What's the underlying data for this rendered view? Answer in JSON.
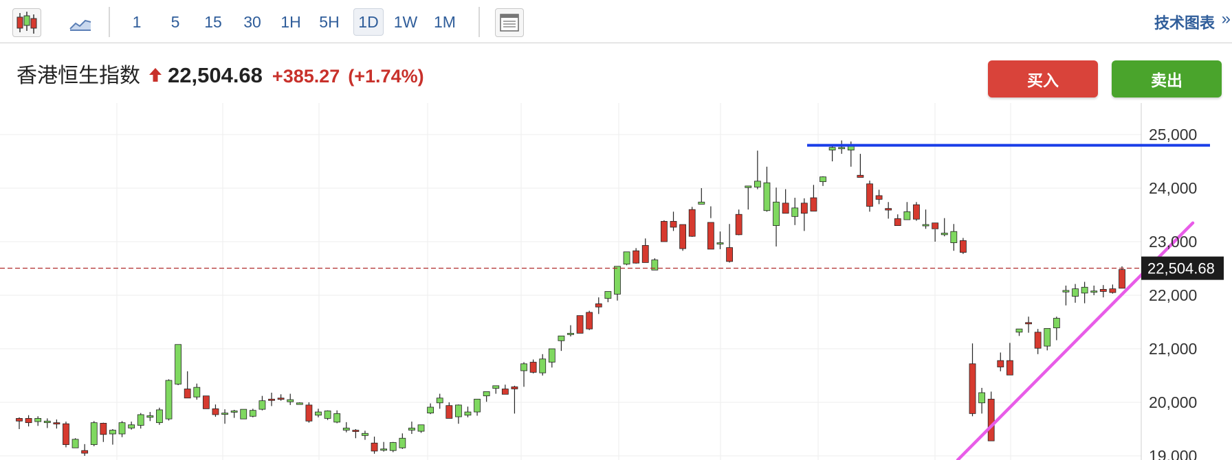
{
  "toolbar": {
    "chart_type_icons": [
      "candlestick-chart-icon",
      "area-chart-icon"
    ],
    "intervals": [
      {
        "label": "1",
        "selected": false
      },
      {
        "label": "5",
        "selected": false
      },
      {
        "label": "15",
        "selected": false
      },
      {
        "label": "30",
        "selected": false
      },
      {
        "label": "1H",
        "selected": false
      },
      {
        "label": "5H",
        "selected": false
      },
      {
        "label": "1D",
        "selected": true
      },
      {
        "label": "1W",
        "selected": false
      },
      {
        "label": "1M",
        "selected": false
      }
    ],
    "layout_icon": "layout-panel-icon",
    "tech_chart_label": "技术图表",
    "tech_chart_chevron": "»"
  },
  "quote": {
    "name": "香港恒生指数",
    "direction_icon": "up-arrow-icon",
    "price": "22,504.68",
    "change": "+385.27",
    "change_pct": "(+1.74%)"
  },
  "actions": {
    "buy_label": "买入",
    "sell_label": "卖出"
  },
  "colors": {
    "up": "#7fd860",
    "down": "#d63a2f",
    "accent": "#2f5d9a",
    "resistance": "#1a3ee8",
    "trendline": "#e85ce8"
  },
  "chart_data": {
    "type": "candlestick",
    "ylim": [
      18900,
      25300
    ],
    "y_ticks": [
      "25,000",
      "24,000",
      "23,000",
      "22,000",
      "21,000",
      "20,000",
      "19,000"
    ],
    "y_tick_values": [
      25000,
      24000,
      23000,
      22000,
      21000,
      20000,
      19000
    ],
    "last_price_value": 22504.68,
    "last_price_label": "22,504.68",
    "candles": [
      [
        19700,
        19720,
        19500,
        19650
      ],
      [
        19700,
        19760,
        19550,
        19620
      ],
      [
        19640,
        19740,
        19560,
        19700
      ],
      [
        19620,
        19700,
        19520,
        19650
      ],
      [
        19620,
        19680,
        19510,
        19600
      ],
      [
        19600,
        19640,
        19160,
        19210
      ],
      [
        19150,
        19330,
        19150,
        19310
      ],
      [
        19100,
        19220,
        19000,
        19050
      ],
      [
        19210,
        19650,
        19180,
        19620
      ],
      [
        19610,
        19620,
        19260,
        19400
      ],
      [
        19410,
        19500,
        19210,
        19480
      ],
      [
        19410,
        19650,
        19350,
        19620
      ],
      [
        19520,
        19640,
        19490,
        19580
      ],
      [
        19570,
        19800,
        19510,
        19770
      ],
      [
        19720,
        19820,
        19650,
        19750
      ],
      [
        19620,
        19900,
        19580,
        19860
      ],
      [
        19690,
        20430,
        19660,
        20410
      ],
      [
        20340,
        21080,
        20320,
        21080
      ],
      [
        20250,
        20580,
        20080,
        20080
      ],
      [
        20100,
        20350,
        20050,
        20280
      ],
      [
        20120,
        20100,
        19880,
        19880
      ],
      [
        19880,
        19960,
        19730,
        19770
      ],
      [
        19800,
        19870,
        19600,
        19800
      ],
      [
        19830,
        19860,
        19710,
        19840
      ],
      [
        19690,
        19860,
        19690,
        19870
      ],
      [
        19740,
        19880,
        19720,
        19850
      ],
      [
        19870,
        20120,
        19850,
        20030
      ],
      [
        20060,
        20180,
        19930,
        20040
      ],
      [
        20080,
        20150,
        20030,
        20060
      ],
      [
        20010,
        20160,
        19950,
        20050
      ],
      [
        19960,
        20000,
        19980,
        19990
      ],
      [
        19950,
        20000,
        19620,
        19650
      ],
      [
        19760,
        19880,
        19720,
        19820
      ],
      [
        19700,
        19850,
        19670,
        19840
      ],
      [
        19630,
        19850,
        19610,
        19790
      ],
      [
        19480,
        19630,
        19440,
        19520
      ],
      [
        19480,
        19500,
        19330,
        19460
      ],
      [
        19380,
        19470,
        19300,
        19420
      ],
      [
        19240,
        19360,
        19040,
        19090
      ],
      [
        19120,
        19260,
        19080,
        19130
      ],
      [
        19100,
        19260,
        19070,
        19250
      ],
      [
        19150,
        19420,
        19130,
        19330
      ],
      [
        19480,
        19640,
        19410,
        19520
      ],
      [
        19460,
        19570,
        19430,
        19580
      ],
      [
        19800,
        19980,
        19780,
        19910
      ],
      [
        19990,
        20160,
        19880,
        20080
      ],
      [
        19940,
        20000,
        19920,
        19700
      ],
      [
        19730,
        19960,
        19600,
        19950
      ],
      [
        19760,
        19920,
        19720,
        19820
      ],
      [
        19820,
        20060,
        19750,
        20060
      ],
      [
        20120,
        20120,
        20010,
        20200
      ],
      [
        20260,
        20280,
        20160,
        20310
      ],
      [
        20250,
        20330,
        20240,
        20150
      ],
      [
        20290,
        20310,
        19790,
        20250
      ],
      [
        20590,
        20750,
        20290,
        20720
      ],
      [
        20750,
        20800,
        20540,
        20560
      ],
      [
        20550,
        20900,
        20500,
        20810
      ],
      [
        20750,
        21000,
        20650,
        21000
      ],
      [
        21150,
        21220,
        20960,
        21240
      ],
      [
        21280,
        21440,
        21230,
        21290
      ],
      [
        21620,
        21600,
        21290,
        21290
      ],
      [
        21680,
        21710,
        21350,
        21370
      ],
      [
        21840,
        21960,
        21650,
        21780
      ],
      [
        21940,
        22020,
        21870,
        22070
      ],
      [
        22020,
        22440,
        21900,
        22540
      ],
      [
        22580,
        22810,
        22560,
        22810
      ],
      [
        22830,
        22880,
        22590,
        22600
      ],
      [
        22930,
        23060,
        22820,
        22610
      ],
      [
        22470,
        22690,
        22490,
        22660
      ],
      [
        23380,
        23400,
        23000,
        23000
      ],
      [
        23380,
        23560,
        23200,
        23270
      ],
      [
        23320,
        23250,
        22830,
        22870
      ],
      [
        23600,
        23650,
        23090,
        23100
      ],
      [
        23700,
        24000,
        23700,
        23740
      ],
      [
        23360,
        23660,
        23440,
        22860
      ],
      [
        22980,
        23190,
        22860,
        22980
      ],
      [
        22890,
        23330,
        22610,
        22630
      ],
      [
        23510,
        23600,
        23120,
        23130
      ],
      [
        24010,
        24040,
        23600,
        24040
      ],
      [
        24020,
        24700,
        23980,
        24130
      ],
      [
        23580,
        24400,
        23560,
        24100
      ],
      [
        23300,
        24010,
        22910,
        23740
      ],
      [
        23720,
        23980,
        23680,
        23530
      ],
      [
        23470,
        23820,
        23310,
        23630
      ],
      [
        23720,
        23810,
        23200,
        23530
      ],
      [
        23820,
        24060,
        23810,
        23570
      ],
      [
        24120,
        24220,
        24040,
        24210
      ],
      [
        24710,
        24790,
        24500,
        24760
      ],
      [
        24750,
        24890,
        24640,
        24760
      ],
      [
        24710,
        24870,
        24400,
        24790
      ],
      [
        24240,
        24640,
        24230,
        24200
      ],
      [
        24080,
        24140,
        23560,
        23660
      ],
      [
        23860,
        23970,
        23700,
        23790
      ],
      [
        23620,
        23740,
        23430,
        23590
      ],
      [
        23430,
        23510,
        23380,
        23300
      ],
      [
        23410,
        23740,
        23410,
        23560
      ],
      [
        23690,
        23740,
        23390,
        23420
      ],
      [
        23320,
        23600,
        23240,
        23320
      ],
      [
        23350,
        23230,
        23000,
        23240
      ],
      [
        23130,
        23440,
        23100,
        23160
      ],
      [
        22980,
        23330,
        22830,
        23190
      ],
      [
        23020,
        23070,
        22770,
        22800
      ],
      [
        20720,
        21100,
        19740,
        19790
      ],
      [
        19990,
        20270,
        19790,
        20180
      ],
      [
        20060,
        20200,
        19280,
        19280
      ],
      [
        20780,
        20930,
        20580,
        20660
      ],
      [
        20780,
        21110,
        20540,
        20510
      ],
      [
        21310,
        21340,
        21240,
        21370
      ],
      [
        21490,
        21600,
        21300,
        21480
      ],
      [
        21310,
        21370,
        20900,
        21010
      ],
      [
        21050,
        21360,
        20970,
        21380
      ],
      [
        21390,
        21600,
        21160,
        21570
      ],
      [
        22060,
        22180,
        21810,
        22090
      ],
      [
        21980,
        22210,
        21860,
        22120
      ],
      [
        22040,
        22250,
        21850,
        22150
      ],
      [
        22080,
        22180,
        22000,
        22080
      ],
      [
        22110,
        22190,
        21960,
        22070
      ],
      [
        22120,
        22200,
        22030,
        22050
      ],
      [
        22480,
        22540,
        22480,
        22130
      ]
    ],
    "resistance_line": {
      "y": 24800
    },
    "trend_line": {
      "from": [
        19000,
        18900
      ],
      "to": [
        0,
        23350
      ]
    }
  }
}
